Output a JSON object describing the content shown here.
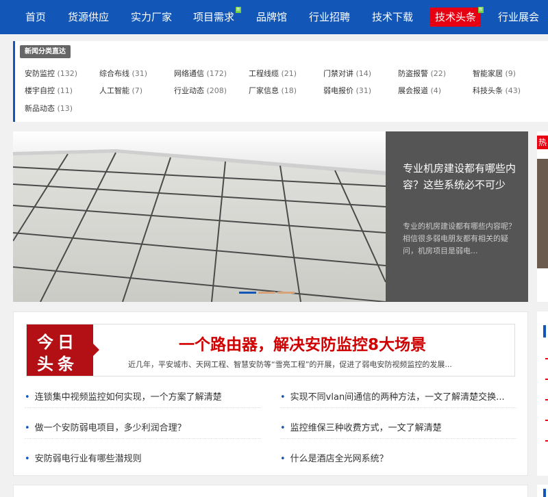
{
  "nav": {
    "items": [
      {
        "label": "首页"
      },
      {
        "label": "货源供应"
      },
      {
        "label": "实力厂家"
      },
      {
        "label": "项目需求",
        "badge": "新"
      },
      {
        "label": "品牌馆"
      },
      {
        "label": "行业招聘"
      },
      {
        "label": "技术下载"
      },
      {
        "label": "技术头条",
        "badge": "新",
        "active": true
      },
      {
        "label": "行业展会"
      }
    ]
  },
  "categories": {
    "title": "新闻分类直达",
    "items": [
      {
        "label": "安防监控",
        "count": "(132)"
      },
      {
        "label": "综合布线",
        "count": "(31)"
      },
      {
        "label": "网络通信",
        "count": "(172)"
      },
      {
        "label": "工程线缆",
        "count": "(21)"
      },
      {
        "label": "门禁对讲",
        "count": "(14)"
      },
      {
        "label": "防盗报警",
        "count": "(22)"
      },
      {
        "label": "智能家居",
        "count": "(9)"
      },
      {
        "label": "楼宇自控",
        "count": "(11)"
      },
      {
        "label": "人工智能",
        "count": "(7)"
      },
      {
        "label": "行业动态",
        "count": "(208)"
      },
      {
        "label": "厂家信息",
        "count": "(18)"
      },
      {
        "label": "弱电报价",
        "count": "(31)"
      },
      {
        "label": "展会报道",
        "count": "(4)"
      },
      {
        "label": "科技头条",
        "count": "(43)"
      },
      {
        "label": "新品动态",
        "count": "(13)"
      }
    ]
  },
  "slider": {
    "title": "专业机房建设都有哪些内容？这些系统必不可少",
    "description": "专业的机房建设都有哪些内容呢？相信很多弱电朋友都有相关的疑问，机房项目是弱电..."
  },
  "hot": {
    "label": "热"
  },
  "headline": {
    "logo_line1": "今日",
    "logo_line2": "头条",
    "title": "一个路由器，解决安防监控8大场景",
    "summary": "近几年，平安城市、天网工程、智慧安防等“雪亮工程”的开展，促进了弱电安防视频监控的发展..."
  },
  "news": {
    "left": [
      "连锁集中视频监控如何实现，一个方案了解清楚",
      "做一个安防弱电项目，多少利润合理？",
      "安防弱电行业有哪些潜规则"
    ],
    "right": [
      "实现不同vlan间通信的两种方法，一文了解清楚交换...",
      "监控维保三种收费方式，一文了解清楚",
      "什么是酒店全光网系统？"
    ]
  },
  "colors": {
    "brand_blue": "#1257b8",
    "accent_red": "#e60012",
    "headline_red": "#d10000"
  }
}
